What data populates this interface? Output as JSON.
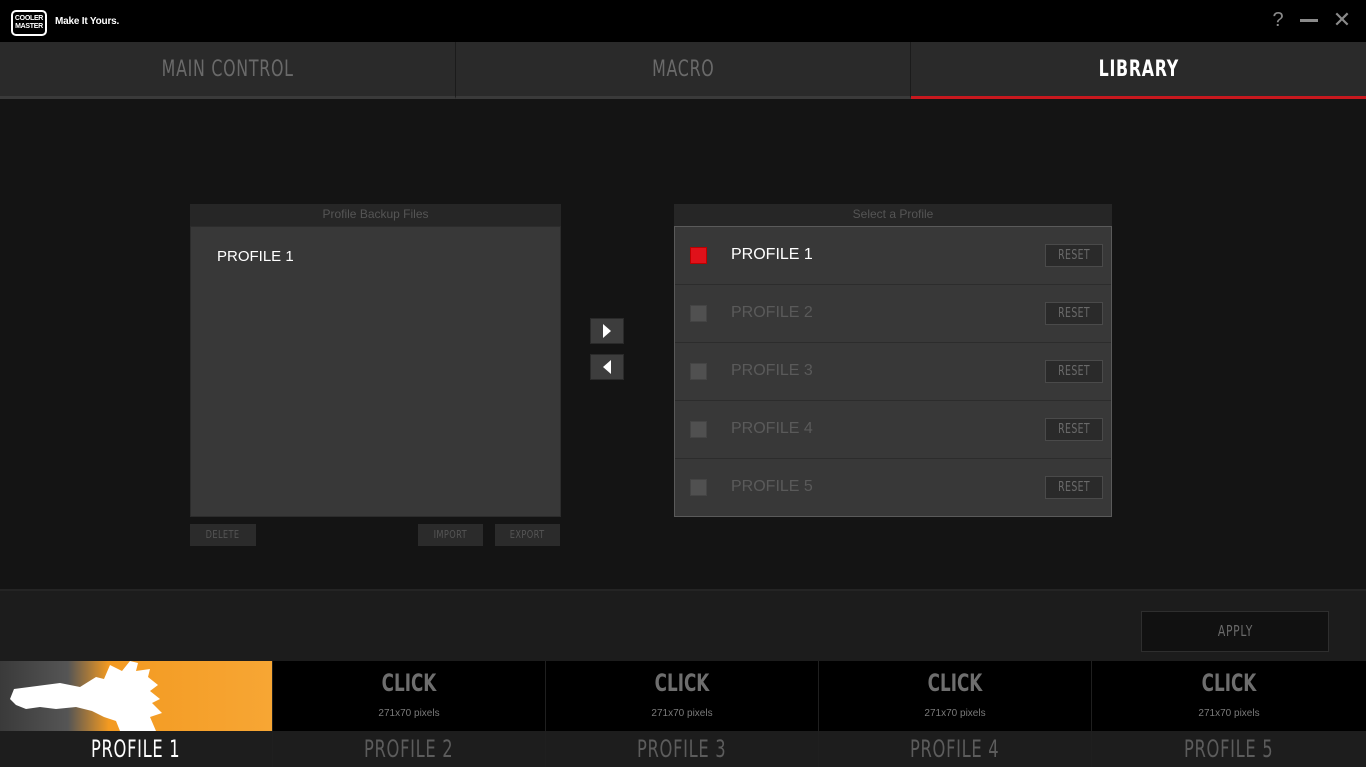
{
  "titlebar": {
    "logo_line1": "COOLER",
    "logo_line2": "MASTER",
    "tagline": "Make It Yours.",
    "help": "?",
    "close": "✕"
  },
  "tabs": [
    {
      "label": "MAIN CONTROL",
      "active": false
    },
    {
      "label": "MACRO",
      "active": false
    },
    {
      "label": "LIBRARY",
      "active": true
    }
  ],
  "backup": {
    "header": "Profile Backup Files",
    "items": [
      "PROFILE 1"
    ],
    "delete_label": "DELETE",
    "import_label": "IMPORT",
    "export_label": "EXPORT"
  },
  "select": {
    "header": "Select a Profile",
    "reset_label": "RESET",
    "profiles": [
      {
        "name": "PROFILE 1",
        "checked": true
      },
      {
        "name": "PROFILE 2",
        "checked": false
      },
      {
        "name": "PROFILE 3",
        "checked": false
      },
      {
        "name": "PROFILE 4",
        "checked": false
      },
      {
        "name": "PROFILE 5",
        "checked": false
      }
    ]
  },
  "apply_label": "APPLY",
  "strip": {
    "click_text": "CLICK",
    "size_text": "271x70 pixels",
    "slots": [
      {
        "label": "PROFILE 1",
        "active": true
      },
      {
        "label": "PROFILE 2",
        "active": false
      },
      {
        "label": "PROFILE 3",
        "active": false
      },
      {
        "label": "PROFILE 4",
        "active": false
      },
      {
        "label": "PROFILE 5",
        "active": false
      }
    ]
  },
  "colors": {
    "accent_red": "#c8181e",
    "checked_red": "#e0111a",
    "profile_orange": "#f7a634"
  }
}
